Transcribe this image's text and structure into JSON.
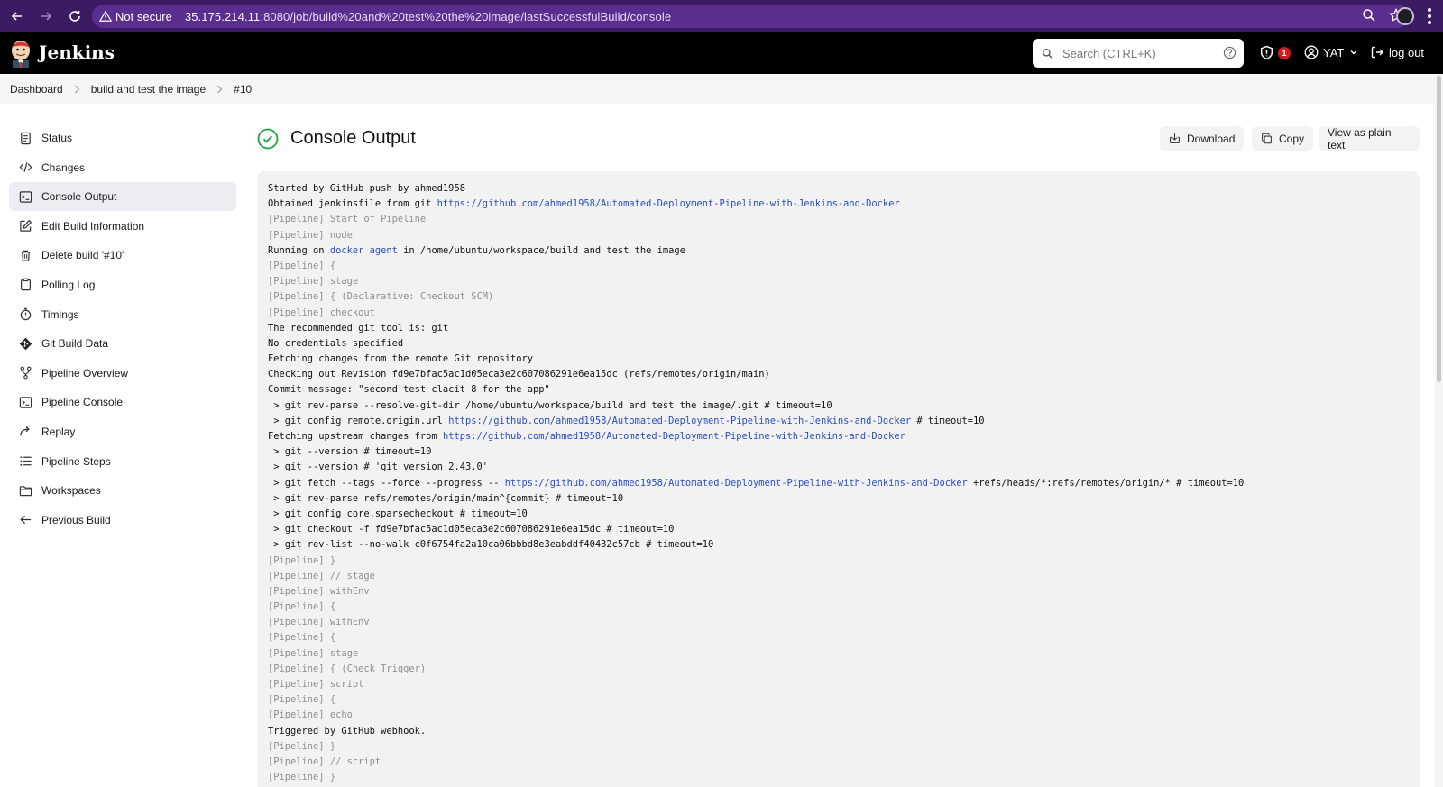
{
  "browser": {
    "security_label": "Not secure",
    "url_host": "35.175.214.11",
    "url_rest": ":8080/job/build%20and%20test%20the%20image/lastSuccessfulBuild/console"
  },
  "header": {
    "app_title": "Jenkins",
    "search_placeholder": "Search (CTRL+K)",
    "security_badge_count": "1",
    "user_name": "YAT",
    "logout_label": "log out"
  },
  "breadcrumb": {
    "items": [
      "Dashboard",
      "build and test the image",
      "#10"
    ]
  },
  "sidebar": {
    "items": [
      {
        "label": "Status",
        "icon": "document-icon"
      },
      {
        "label": "Changes",
        "icon": "code-icon"
      },
      {
        "label": "Console Output",
        "icon": "terminal-icon",
        "active": true
      },
      {
        "label": "Edit Build Information",
        "icon": "edit-icon"
      },
      {
        "label": "Delete build '#10'",
        "icon": "trash-icon"
      },
      {
        "label": "Polling Log",
        "icon": "clipboard-icon"
      },
      {
        "label": "Timings",
        "icon": "stopwatch-icon"
      },
      {
        "label": "Git Build Data",
        "icon": "git-icon"
      },
      {
        "label": "Pipeline Overview",
        "icon": "pipeline-graph-icon"
      },
      {
        "label": "Pipeline Console",
        "icon": "terminal-icon"
      },
      {
        "label": "Replay",
        "icon": "replay-icon"
      },
      {
        "label": "Pipeline Steps",
        "icon": "list-icon"
      },
      {
        "label": "Workspaces",
        "icon": "folder-icon"
      },
      {
        "label": "Previous Build",
        "icon": "arrow-left-icon"
      }
    ]
  },
  "main": {
    "title": "Console Output",
    "status": "success",
    "actions": {
      "download": "Download",
      "copy": "Copy",
      "plain_text": "View as plain text"
    }
  },
  "console": {
    "lines": [
      {
        "text": "Started by GitHub push by ahmed1958"
      },
      {
        "text": "Obtained jenkinsfile from git ",
        "link": "https://github.com/ahmed1958/Automated-Deployment-Pipeline-with-Jenkins-and-Docker"
      },
      {
        "text": "[Pipeline] Start of Pipeline",
        "dim": true
      },
      {
        "text": "[Pipeline] node",
        "dim": true
      },
      {
        "text": "Running on ",
        "link": "docker agent",
        "after": " in /home/ubuntu/workspace/build and test the image"
      },
      {
        "text": "[Pipeline] {",
        "dim": true
      },
      {
        "text": "[Pipeline] stage",
        "dim": true
      },
      {
        "text": "[Pipeline] { (Declarative: Checkout SCM)",
        "dim": true
      },
      {
        "text": "[Pipeline] checkout",
        "dim": true
      },
      {
        "text": "The recommended git tool is: git"
      },
      {
        "text": "No credentials specified"
      },
      {
        "text": "Fetching changes from the remote Git repository"
      },
      {
        "text": "Checking out Revision fd9e7bfac5ac1d05eca3e2c607086291e6ea15dc (refs/remotes/origin/main)"
      },
      {
        "text": "Commit message: \"second test clacit 8 for the app\""
      },
      {
        "text": " > git rev-parse --resolve-git-dir /home/ubuntu/workspace/build and test the image/.git # timeout=10"
      },
      {
        "text": " > git config remote.origin.url ",
        "link": "https://github.com/ahmed1958/Automated-Deployment-Pipeline-with-Jenkins-and-Docker",
        "after": " # timeout=10"
      },
      {
        "text": "Fetching upstream changes from ",
        "link": "https://github.com/ahmed1958/Automated-Deployment-Pipeline-with-Jenkins-and-Docker"
      },
      {
        "text": " > git --version # timeout=10"
      },
      {
        "text": " > git --version # 'git version 2.43.0'"
      },
      {
        "text": " > git fetch --tags --force --progress -- ",
        "link": "https://github.com/ahmed1958/Automated-Deployment-Pipeline-with-Jenkins-and-Docker",
        "after": " +refs/heads/*:refs/remotes/origin/* # timeout=10"
      },
      {
        "text": " > git rev-parse refs/remotes/origin/main^{commit} # timeout=10"
      },
      {
        "text": " > git config core.sparsecheckout # timeout=10"
      },
      {
        "text": " > git checkout -f fd9e7bfac5ac1d05eca3e2c607086291e6ea15dc # timeout=10"
      },
      {
        "text": " > git rev-list --no-walk c0f6754fa2a10ca06bbbd8e3eabddf40432c57cb # timeout=10"
      },
      {
        "text": "[Pipeline] }",
        "dim": true
      },
      {
        "text": "[Pipeline] // stage",
        "dim": true
      },
      {
        "text": "[Pipeline] withEnv",
        "dim": true
      },
      {
        "text": "[Pipeline] {",
        "dim": true
      },
      {
        "text": "[Pipeline] withEnv",
        "dim": true
      },
      {
        "text": "[Pipeline] {",
        "dim": true
      },
      {
        "text": "[Pipeline] stage",
        "dim": true
      },
      {
        "text": "[Pipeline] { (Check Trigger)",
        "dim": true
      },
      {
        "text": "[Pipeline] script",
        "dim": true
      },
      {
        "text": "[Pipeline] {",
        "dim": true
      },
      {
        "text": "[Pipeline] echo",
        "dim": true
      },
      {
        "text": "Triggered by GitHub webhook."
      },
      {
        "text": "[Pipeline] }",
        "dim": true
      },
      {
        "text": "[Pipeline] // script",
        "dim": true
      },
      {
        "text": "[Pipeline] }",
        "dim": true
      }
    ]
  },
  "colors": {
    "browser_bar": "#3b1c63",
    "omnibox": "#5a2d8f",
    "jenkins_header": "#000000",
    "success_green": "#1ea446",
    "link_blue": "#2a4cc8",
    "badge_red": "#d61a1a"
  }
}
